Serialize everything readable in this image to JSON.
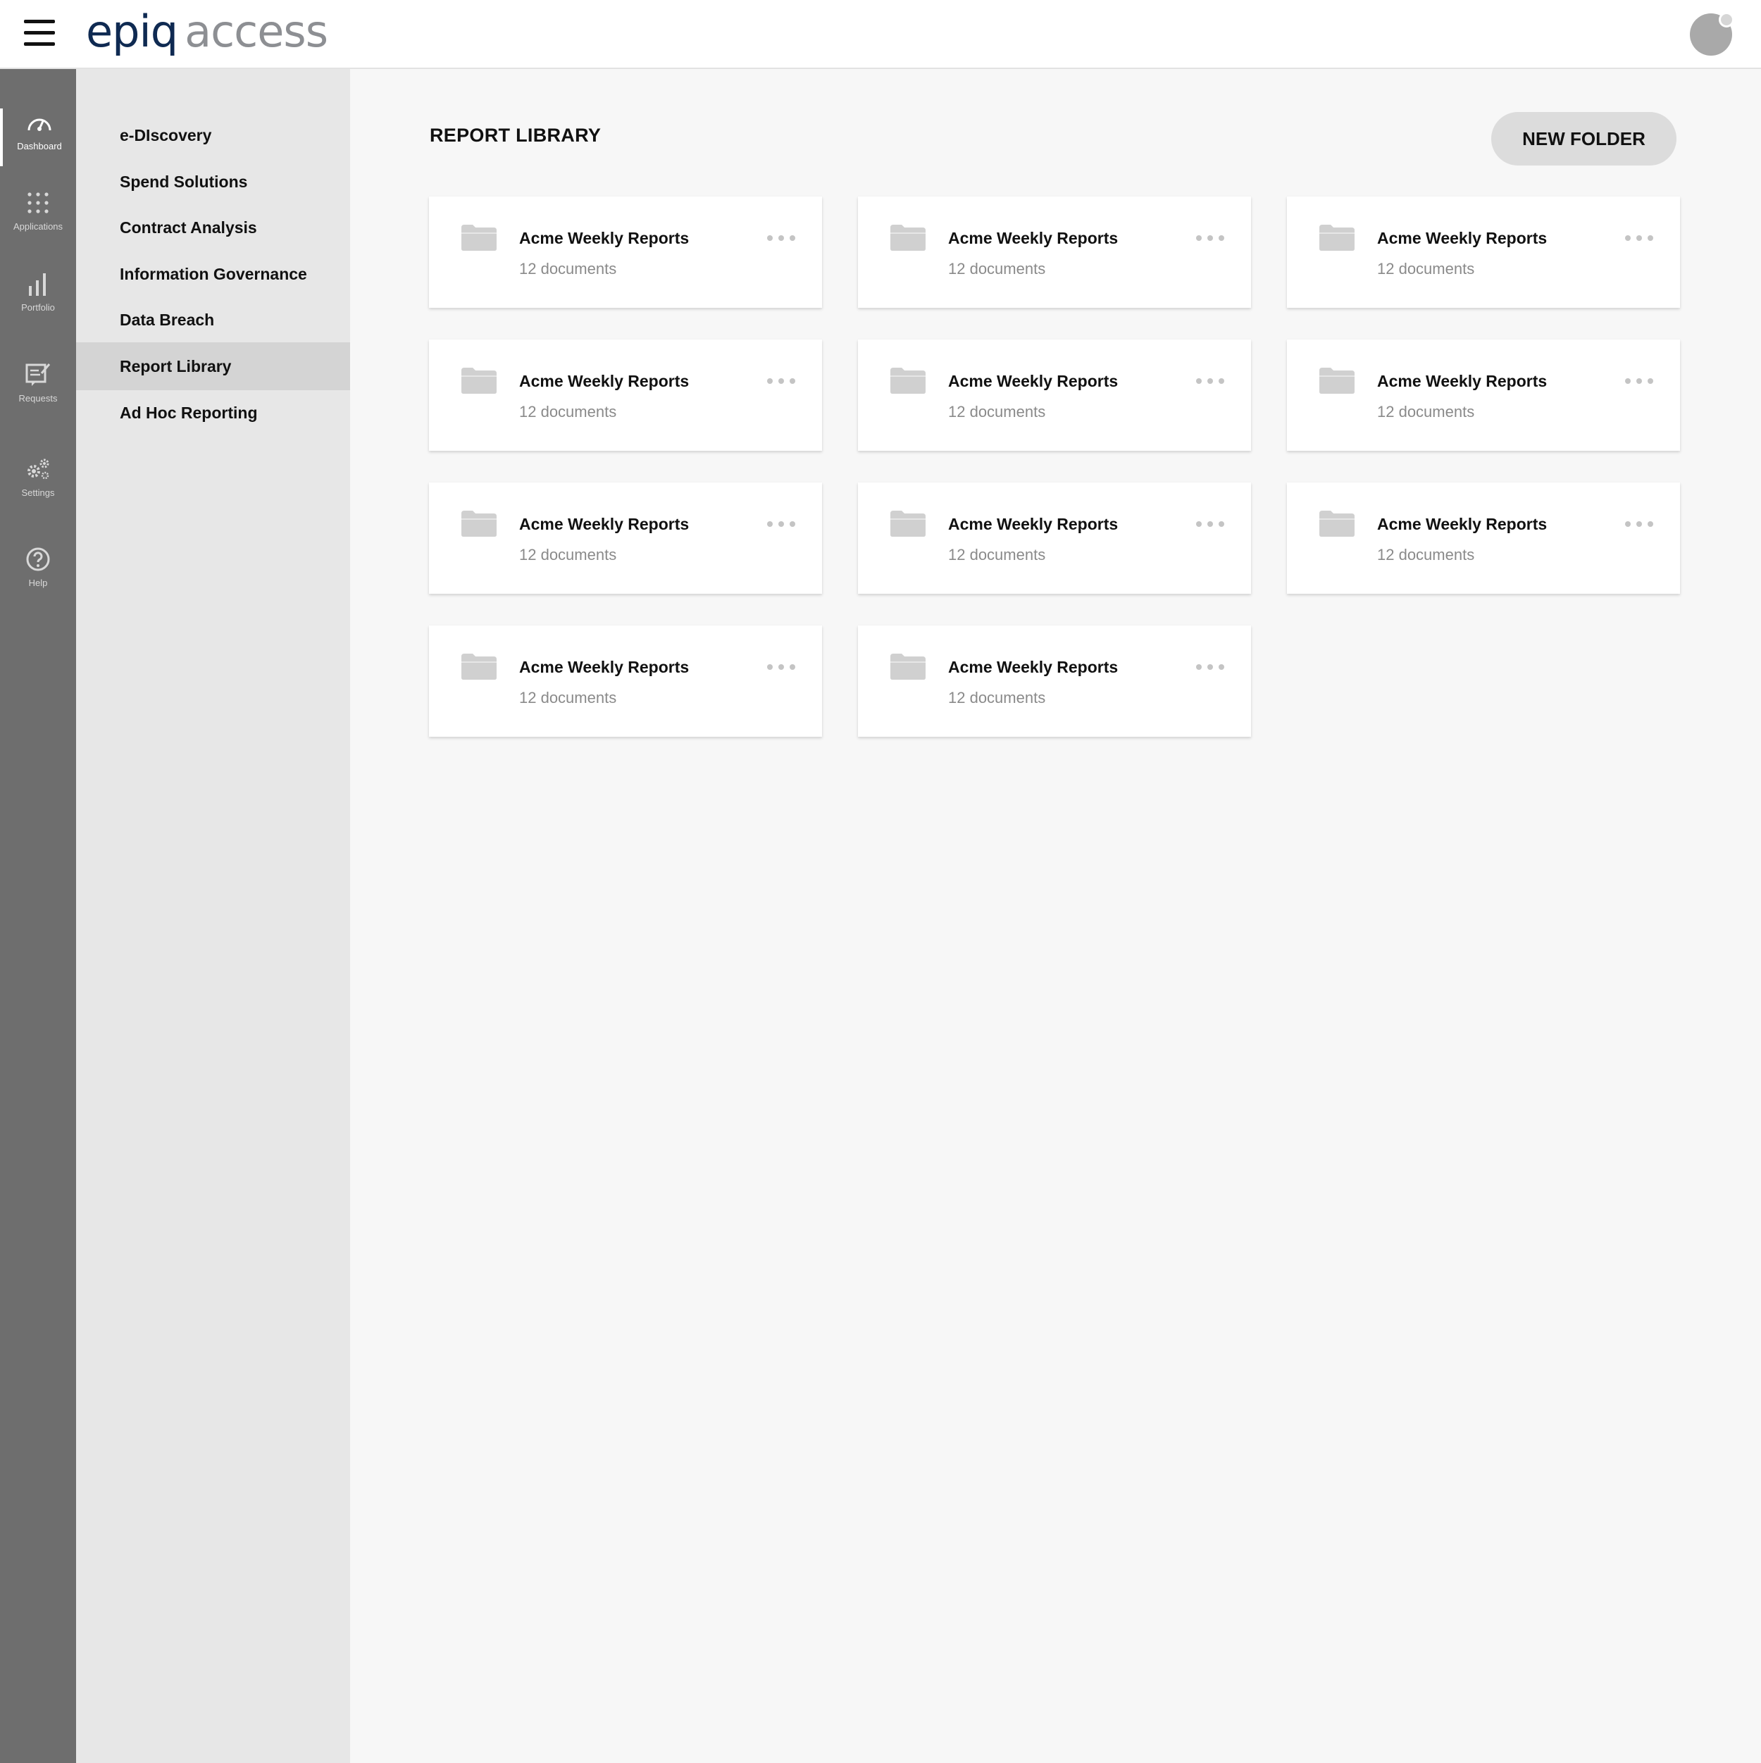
{
  "header": {
    "logo_primary": "epiq",
    "logo_secondary": "access"
  },
  "rail": [
    {
      "label": "Dashboard",
      "icon": "speedometer-icon",
      "active": true
    },
    {
      "label": "Applications",
      "icon": "grid-dots-icon",
      "active": false
    },
    {
      "label": "Portfolio",
      "icon": "bar-chart-icon",
      "active": false
    },
    {
      "label": "Requests",
      "icon": "edit-document-icon",
      "active": false
    },
    {
      "label": "Settings",
      "icon": "gears-icon",
      "active": false
    },
    {
      "label": "Help",
      "icon": "help-circle-icon",
      "active": false
    }
  ],
  "subnav": [
    {
      "label": "e-DIscovery",
      "active": false
    },
    {
      "label": "Spend Solutions",
      "active": false
    },
    {
      "label": "Contract Analysis",
      "active": false
    },
    {
      "label": "Information Governance",
      "active": false
    },
    {
      "label": "Data Breach",
      "active": false
    },
    {
      "label": "Report Library",
      "active": true
    },
    {
      "label": "Ad Hoc Reporting",
      "active": false
    }
  ],
  "main": {
    "title": "REPORT LIBRARY",
    "new_folder_label": "NEW FOLDER",
    "folders": [
      {
        "name": "Acme Weekly Reports",
        "count": "12 documents"
      },
      {
        "name": "Acme Weekly Reports",
        "count": "12 documents"
      },
      {
        "name": "Acme Weekly Reports",
        "count": "12 documents"
      },
      {
        "name": "Acme Weekly Reports",
        "count": "12 documents"
      },
      {
        "name": "Acme Weekly Reports",
        "count": "12 documents"
      },
      {
        "name": "Acme Weekly Reports",
        "count": "12 documents"
      },
      {
        "name": "Acme Weekly Reports",
        "count": "12 documents"
      },
      {
        "name": "Acme Weekly Reports",
        "count": "12 documents"
      },
      {
        "name": "Acme Weekly Reports",
        "count": "12 documents"
      },
      {
        "name": "Acme Weekly Reports",
        "count": "12 documents"
      },
      {
        "name": "Acme Weekly Reports",
        "count": "12 documents"
      }
    ]
  },
  "colors": {
    "rail_bg": "#6e6e6e",
    "subnav_bg": "#e7e7e7",
    "subnav_active_bg": "#d4d4d4",
    "logo_primary": "#0f2a52",
    "logo_secondary": "#8d8f93"
  }
}
